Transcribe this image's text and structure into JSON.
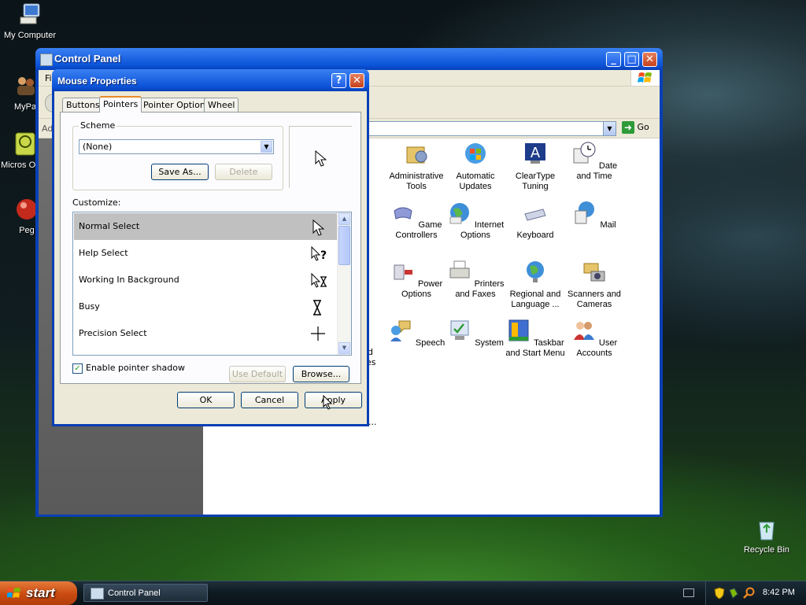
{
  "desktop": {
    "icons": [
      {
        "label": "My Computer"
      },
      {
        "label": "MyPa"
      },
      {
        "label": "Micros Outlo"
      },
      {
        "label": "Peg"
      },
      {
        "label": "Recycle Bin"
      }
    ]
  },
  "control_panel": {
    "title": "Control Panel",
    "menu_fragment": "Fi",
    "address_fragment": "Ad",
    "go_label": "Go",
    "left_fragments": [
      "d",
      "es"
    ],
    "bottom_fragment": "...",
    "items": [
      {
        "label": "Administrative Tools",
        "icon": "admin-tools-icon"
      },
      {
        "label": "Automatic Updates",
        "icon": "windows-update-icon"
      },
      {
        "label": "ClearType Tuning",
        "icon": "cleartype-icon"
      },
      {
        "label": "Date and Time",
        "icon": "clock-icon"
      },
      {
        "label": "Game Controllers",
        "icon": "gamepad-icon"
      },
      {
        "label": "Internet Options",
        "icon": "globe-icon"
      },
      {
        "label": "Keyboard",
        "icon": "keyboard-icon"
      },
      {
        "label": "Mail",
        "icon": "mail-icon"
      },
      {
        "label": "Power Options",
        "icon": "power-icon"
      },
      {
        "label": "Printers and Faxes",
        "icon": "printer-icon"
      },
      {
        "label": "Regional and Language ...",
        "icon": "globe-icon"
      },
      {
        "label": "Scanners and Cameras",
        "icon": "camera-icon"
      },
      {
        "label": "Speech",
        "icon": "speech-icon"
      },
      {
        "label": "System",
        "icon": "system-icon"
      },
      {
        "label": "Taskbar and Start Menu",
        "icon": "taskbar-icon"
      },
      {
        "label": "User Accounts",
        "icon": "users-icon"
      }
    ]
  },
  "dialog": {
    "title": "Mouse Properties",
    "tabs": [
      "Buttons",
      "Pointers",
      "Pointer Options",
      "Wheel"
    ],
    "active_tab": "Pointers",
    "scheme_label": "Scheme",
    "scheme_value": "(None)",
    "save_as": "Save As...",
    "delete": "Delete",
    "customize_label": "Customize:",
    "pointers": [
      {
        "label": "Normal Select",
        "cursor": "arrow-cursor-icon",
        "selected": true
      },
      {
        "label": "Help Select",
        "cursor": "help-cursor-icon",
        "selected": false
      },
      {
        "label": "Working In Background",
        "cursor": "working-cursor-icon",
        "selected": false
      },
      {
        "label": "Busy",
        "cursor": "hourglass-cursor-icon",
        "selected": false
      },
      {
        "label": "Precision Select",
        "cursor": "crosshair-cursor-icon",
        "selected": false
      }
    ],
    "shadow_label": "Enable pointer shadow",
    "shadow_checked": true,
    "use_default": "Use Default",
    "browse": "Browse...",
    "ok": "OK",
    "cancel": "Cancel",
    "apply": "Apply",
    "help_glyph": "?",
    "close_glyph": "✕"
  },
  "window_controls": {
    "minimize": "_",
    "maximize": "□",
    "close": "✕"
  },
  "taskbar": {
    "start_label": "start",
    "task_label": "Control Panel",
    "clock": "8:42 PM"
  }
}
